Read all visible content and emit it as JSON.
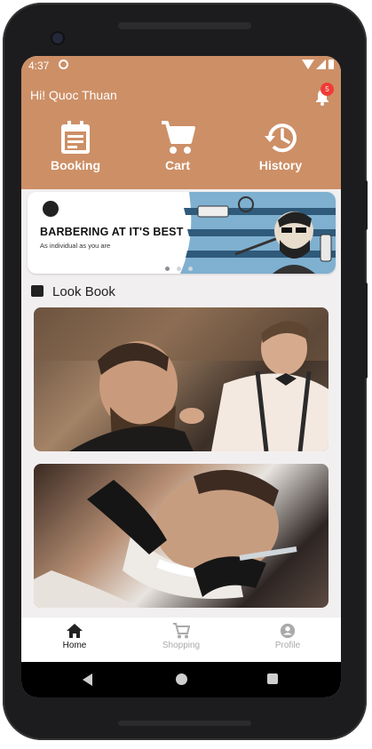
{
  "status_bar": {
    "time": "4:37"
  },
  "header": {
    "greeting": "Hi! Quoc Thuan",
    "notification_count": "5",
    "menu": [
      {
        "label": "Booking",
        "icon": "calendar-icon"
      },
      {
        "label": "Cart",
        "icon": "cart-icon"
      },
      {
        "label": "History",
        "icon": "history-icon"
      }
    ]
  },
  "banner": {
    "title": "BARBERING AT IT'S BEST",
    "subtitle": "As individual as you are",
    "slide_count": 3,
    "active_slide": 0
  },
  "lookbook": {
    "title": "Look Book",
    "icon": "image-icon"
  },
  "bottom_nav": {
    "items": [
      {
        "label": "Home",
        "icon": "home-icon",
        "active": true
      },
      {
        "label": "Shopping",
        "icon": "cart-icon",
        "active": false
      },
      {
        "label": "Profile",
        "icon": "account-icon",
        "active": false
      }
    ]
  },
  "colors": {
    "header": "#cd8f66",
    "badge": "#ef3b36",
    "screen_bg": "#f2eff0"
  }
}
